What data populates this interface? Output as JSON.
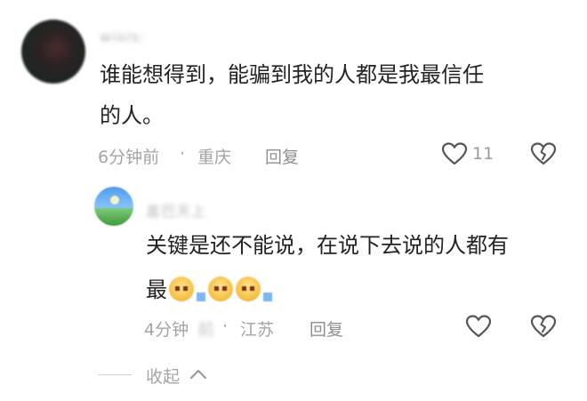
{
  "comments": [
    {
      "username": "wiois:",
      "text_line1": "谁能想得到，能骗到我的人都是我最信任",
      "text_line2": "的人。",
      "time": "6分钟前",
      "location": "重庆",
      "separator": "·",
      "reply_label": "回复",
      "like_count": "11"
    },
    {
      "username": "盖巴天上",
      "text_line1": "关键是还不能说，在说下去说的人都有",
      "text_line2": "最",
      "time_prefix": "4分钟",
      "time_suffix": "前",
      "location": "江苏",
      "separator": "·",
      "reply_label": "回复"
    }
  ],
  "collapse_label": "收起",
  "icons": {
    "like": "heart-outline-icon",
    "dislike": "broken-heart-icon",
    "collapse": "chevron-up-icon"
  },
  "colors": {
    "text": "#222222",
    "meta": "#a4a4a4",
    "icon": "#555555"
  }
}
